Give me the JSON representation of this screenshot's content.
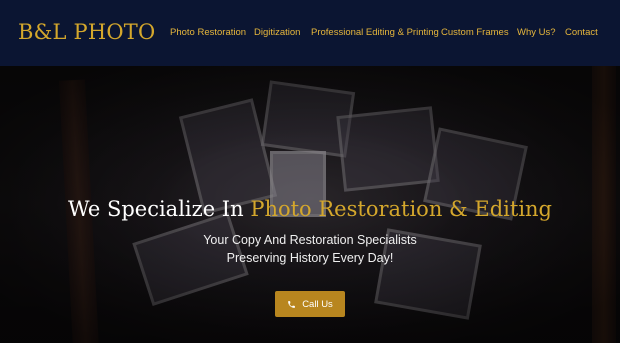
{
  "brand": "B&L PHOTO",
  "nav": [
    {
      "label": "Photo Restoration"
    },
    {
      "label": "Digitization"
    },
    {
      "label": "Professional Editing & Printing"
    },
    {
      "label": "Custom Frames"
    },
    {
      "label": "Why Us?"
    },
    {
      "label": "Contact"
    }
  ],
  "hero": {
    "title_prefix": "We Specialize In",
    "title_accent": "Photo Restoration & Editing",
    "subtitle_line1": "Your Copy And Restoration Specialists",
    "subtitle_line2": "Preserving History Every Day!",
    "cta_label": "Call Us",
    "cta_icon": "phone-icon"
  },
  "colors": {
    "nav_bg": "#0b1532",
    "accent": "#d4a72c",
    "button": "#b8861f"
  }
}
